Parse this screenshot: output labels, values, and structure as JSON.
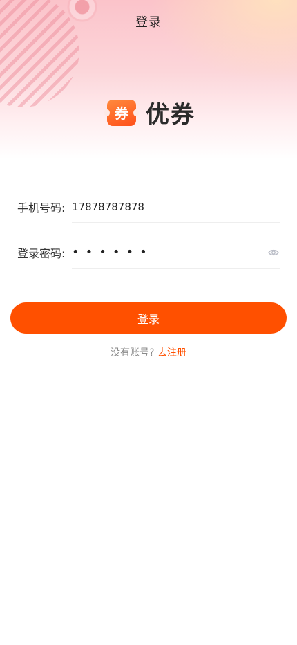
{
  "header": {
    "title": "登录"
  },
  "brand": {
    "badge_text": "券",
    "name": "优券",
    "accent": "#ff5000"
  },
  "form": {
    "phone": {
      "label": "手机号码:",
      "value": "17878787878"
    },
    "password": {
      "label": "登录密码:",
      "value_masked": "••••••",
      "toggle_icon": "eye-icon"
    }
  },
  "actions": {
    "login_label": "登录"
  },
  "footer": {
    "prompt": "没有账号?",
    "register_link": "去注册"
  }
}
